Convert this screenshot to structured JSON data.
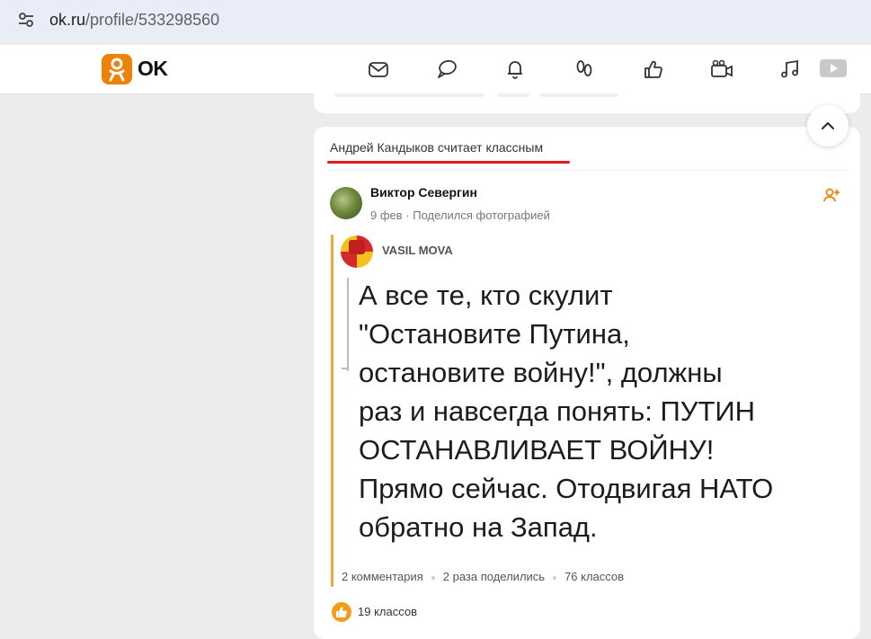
{
  "browser": {
    "url_host": "ok.ru",
    "url_path": "/profile/533298560"
  },
  "header": {
    "logo_text": "OK",
    "nav_icons": [
      "mail-icon",
      "chat-icon",
      "notifications-icon",
      "guests-icon",
      "likes-icon",
      "video-icon",
      "music-icon",
      "play-icon"
    ]
  },
  "post": {
    "liked_by": "Андрей Кандыков считает классным",
    "author": "Виктор Севергин",
    "date": "9 фев",
    "action": "Поделился фотографией",
    "source_name": "VASIL MOVA",
    "photo_text": [
      "А все те, кто скулит",
      "\"Остановите Путина,",
      "остановите войну!\", должны",
      "раз и навсегда понять: ПУТИН",
      "ОСТАНАВЛИВАЕТ ВОЙНУ!",
      "Прямо сейчас. Отодвигая НАТО",
      "обратно на Запад."
    ],
    "stats": {
      "comments": "2 комментария",
      "shares": "2 раза поделились",
      "classes": "76 классов"
    },
    "likes": "19 классов"
  },
  "colors": {
    "brand": "#ee8208",
    "accent_red": "#e01b22",
    "quote": "#f0a63a"
  }
}
